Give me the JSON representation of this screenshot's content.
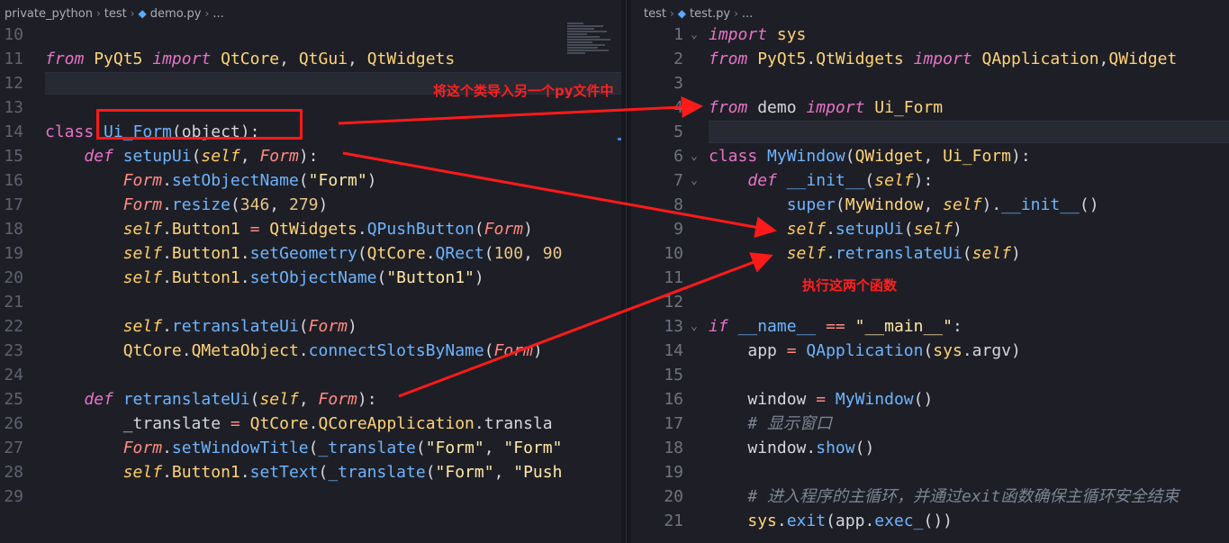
{
  "left_editor": {
    "breadcrumb": [
      "private_python",
      "test",
      "demo.py",
      "..."
    ],
    "current_line": "12",
    "lines": [
      {
        "n": "10",
        "t": ""
      },
      {
        "n": "11",
        "t": "from PyQt5 import QtCore, QtGui, QtWidgets"
      },
      {
        "n": "12",
        "t": ""
      },
      {
        "n": "13",
        "t": ""
      },
      {
        "n": "14",
        "t": "class Ui_Form(object):"
      },
      {
        "n": "15",
        "t": "    def setupUi(self, Form):"
      },
      {
        "n": "16",
        "t": "        Form.setObjectName(\"Form\")"
      },
      {
        "n": "17",
        "t": "        Form.resize(346, 279)"
      },
      {
        "n": "18",
        "t": "        self.Button1 = QtWidgets.QPushButton(Form)"
      },
      {
        "n": "19",
        "t": "        self.Button1.setGeometry(QtCore.QRect(100, 90"
      },
      {
        "n": "20",
        "t": "        self.Button1.setObjectName(\"Button1\")"
      },
      {
        "n": "21",
        "t": ""
      },
      {
        "n": "22",
        "t": "        self.retranslateUi(Form)"
      },
      {
        "n": "23",
        "t": "        QtCore.QMetaObject.connectSlotsByName(Form)"
      },
      {
        "n": "24",
        "t": ""
      },
      {
        "n": "25",
        "t": "    def retranslateUi(self, Form):"
      },
      {
        "n": "26",
        "t": "        _translate = QtCore.QCoreApplication.transla"
      },
      {
        "n": "27",
        "t": "        Form.setWindowTitle(_translate(\"Form\", \"Form\""
      },
      {
        "n": "28",
        "t": "        self.Button1.setText(_translate(\"Form\", \"Push"
      },
      {
        "n": "29",
        "t": ""
      }
    ]
  },
  "right_editor": {
    "breadcrumb": [
      "test",
      "test.py",
      "..."
    ],
    "current_line": "5",
    "lines": [
      {
        "n": "1",
        "t": "import sys",
        "fold": true
      },
      {
        "n": "2",
        "t": "from PyQt5.QtWidgets import QApplication,QWidget"
      },
      {
        "n": "3",
        "t": ""
      },
      {
        "n": "4",
        "t": "from demo import Ui_Form"
      },
      {
        "n": "5",
        "t": ""
      },
      {
        "n": "6",
        "t": "class MyWindow(QWidget, Ui_Form):",
        "fold": true
      },
      {
        "n": "7",
        "t": "    def __init__(self):",
        "fold": true
      },
      {
        "n": "8",
        "t": "        super(MyWindow, self).__init__()"
      },
      {
        "n": "9",
        "t": "        self.setupUi(self)"
      },
      {
        "n": "10",
        "t": "        self.retranslateUi(self)"
      },
      {
        "n": "11",
        "t": ""
      },
      {
        "n": "12",
        "t": ""
      },
      {
        "n": "13",
        "t": "if __name__ == \"__main__\":",
        "fold": true
      },
      {
        "n": "14",
        "t": "    app = QApplication(sys.argv)"
      },
      {
        "n": "15",
        "t": ""
      },
      {
        "n": "16",
        "t": "    window = MyWindow()"
      },
      {
        "n": "17",
        "t": "    # 显示窗口"
      },
      {
        "n": "18",
        "t": "    window.show()"
      },
      {
        "n": "19",
        "t": ""
      },
      {
        "n": "20",
        "t": "    # 进入程序的主循环，并通过exit函数确保主循环安全结束"
      },
      {
        "n": "21",
        "t": "    sys.exit(app.exec_())"
      }
    ]
  },
  "annotations": {
    "import_note": "将这个类导入另一个py文件中",
    "execute_note": "执行这两个函数",
    "color": "#ff1a1a"
  }
}
